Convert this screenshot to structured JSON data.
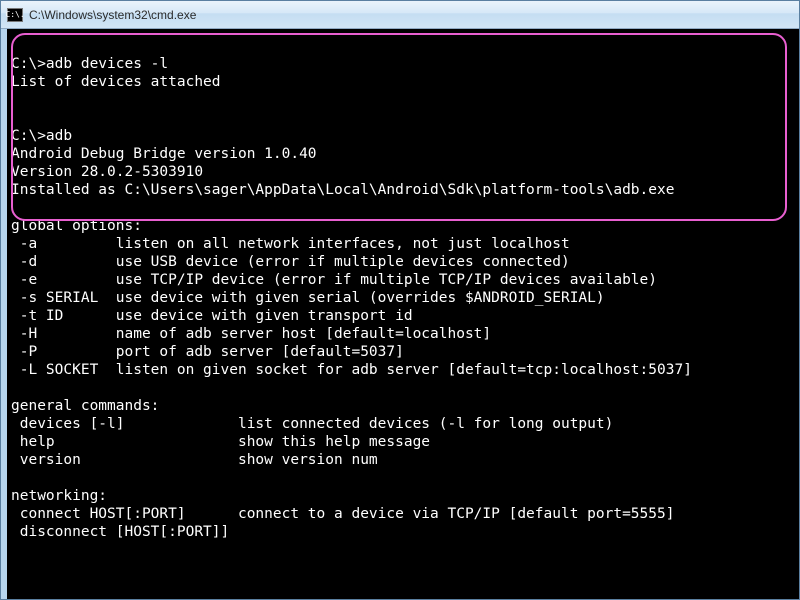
{
  "window": {
    "icon_label": "C:\\.",
    "title": "C:\\Windows\\system32\\cmd.exe"
  },
  "terminal": {
    "lines": [
      "",
      "C:\\>adb devices -l",
      "List of devices attached",
      "",
      "",
      "C:\\>adb",
      "Android Debug Bridge version 1.0.40",
      "Version 28.0.2-5303910",
      "Installed as C:\\Users\\sager\\AppData\\Local\\Android\\Sdk\\platform-tools\\adb.exe",
      "",
      "global options:",
      " -a         listen on all network interfaces, not just localhost",
      " -d         use USB device (error if multiple devices connected)",
      " -e         use TCP/IP device (error if multiple TCP/IP devices available)",
      " -s SERIAL  use device with given serial (overrides $ANDROID_SERIAL)",
      " -t ID      use device with given transport id",
      " -H         name of adb server host [default=localhost]",
      " -P         port of adb server [default=5037]",
      " -L SOCKET  listen on given socket for adb server [default=tcp:localhost:5037]",
      "",
      "general commands:",
      " devices [-l]             list connected devices (-l for long output)",
      " help                     show this help message",
      " version                  show version num",
      "",
      "networking:",
      " connect HOST[:PORT]      connect to a device via TCP/IP [default port=5555]",
      " disconnect [HOST[:PORT]]"
    ]
  }
}
